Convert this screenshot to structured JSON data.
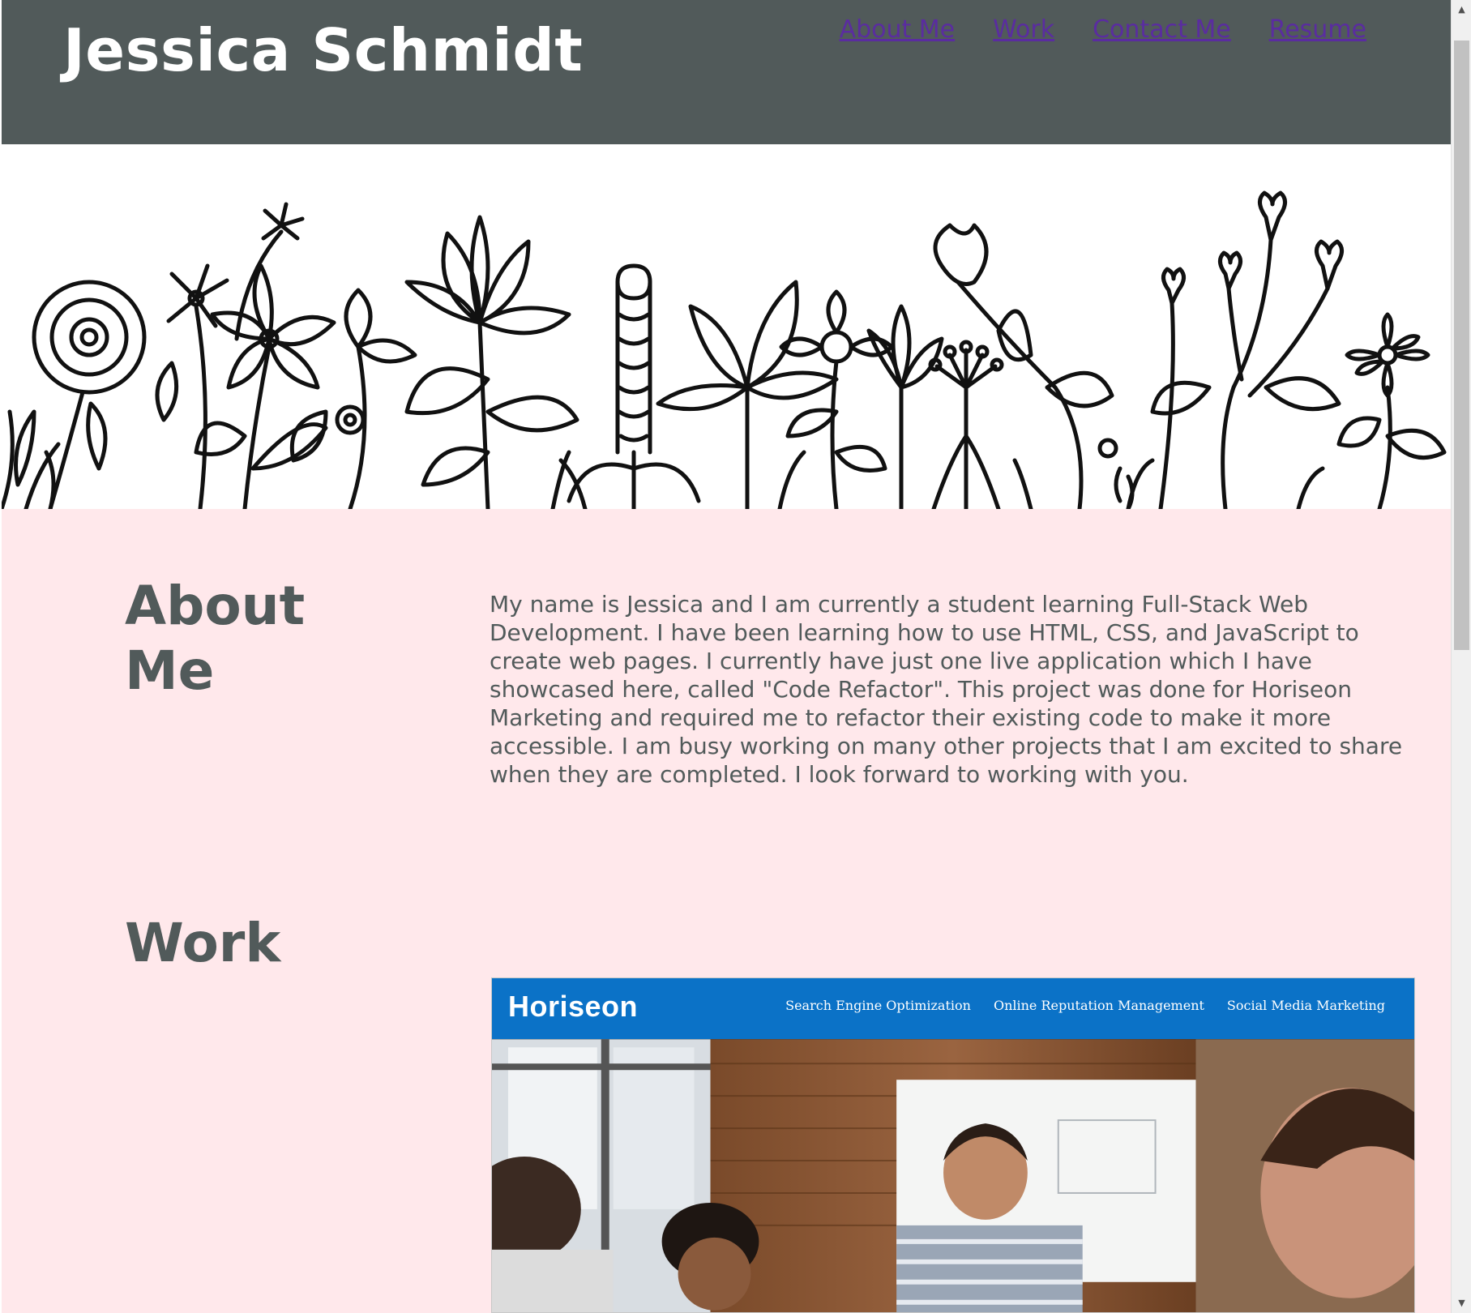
{
  "header": {
    "title": "Jessica Schmidt",
    "nav": [
      "About Me",
      "Work",
      "Contact Me",
      "Resume"
    ]
  },
  "hero": {
    "image": "floral-line-art-banner"
  },
  "about": {
    "heading": "About Me",
    "text": "My name is Jessica and I am currently a student learning Full-Stack Web Development. I have been learning how to use HTML, CSS, and JavaScript to create web pages. I currently have just one live application which I have showcased here, called \"Code Refactor\". This project was done for Horiseon Marketing and required me to refactor their existing code to make it more accessible. I am busy working on many other projects that I am excited to share when they are completed. I look forward to working with you."
  },
  "work": {
    "heading": "Work",
    "project": {
      "logo": "Horiseon",
      "nav": [
        "Search Engine Optimization",
        "Online Reputation Management",
        "Social Media Marketing"
      ]
    }
  },
  "colors": {
    "header_bg": "#515a5a",
    "page_bg": "#ffe8eb",
    "link": "#5a2ca0",
    "horiseon_blue": "#0b72c7"
  }
}
